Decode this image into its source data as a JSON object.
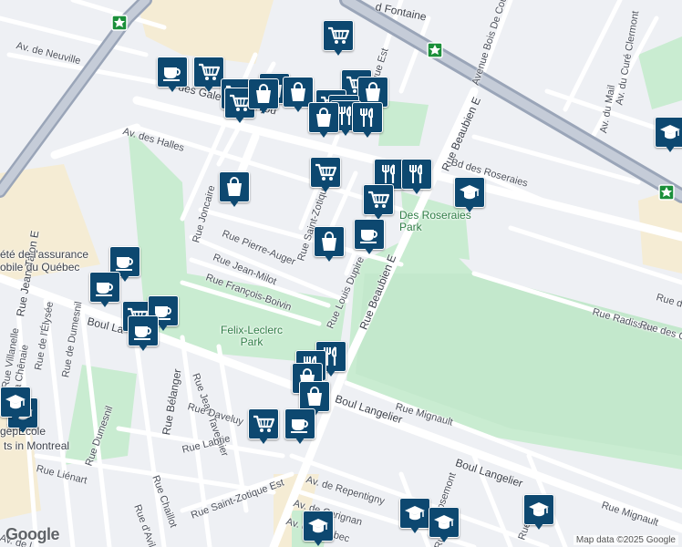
{
  "streets": {
    "fontaine": "d Fontaine",
    "bois_de_coulonges": "Avenue Bois De Coulonges",
    "cure_clermont": "Av. du Curé Clermont",
    "mail": "Av. du Mail",
    "neuville": "Av. de Neuville",
    "galeries": "des Galeries d'Anjou",
    "zotique_top": "tique Est",
    "beaubien_top": "Rue Beaubien E",
    "roseraies": "Bd des Roseraies",
    "halles": "Av. des Halles",
    "jean_talon": "Rue Jean-Talon E",
    "joncaire": "Rue Joncaire",
    "saint_zotique": "Rue Saint-Zotique",
    "pierre_auger": "Rue Pierre-Auger",
    "jean_milot": "Rue Jean-Milot",
    "francois_boivin": "Rue François-Boivin",
    "louis_dupire": "Rue Louis Dupire",
    "beaubien": "Rue Beaubien E",
    "radisson": "Rue Radisson",
    "trianon": "Rue du Tri",
    "gros": "Rue des Gros",
    "boul_la": "Boul La",
    "villanelle": "Rue Villanelle",
    "dumesnil": "Rue de Dumesnil",
    "elysee": "Rue de l'Élysée",
    "chenaie": "Rue de la Chênaie",
    "belanger": "Rue Bélanger",
    "jean_tavernier": "Rue Jean-Tavernier",
    "daveluy": "Rue Daveluy",
    "boul_langelier": "Boul Langelier",
    "boul_langelier2": "Boul Langelier",
    "mignault": "Rue Mignault",
    "mignault2": "Rue Mignault",
    "labrie": "Rue Labrie",
    "dumesnil2": "Rue Dumesnil",
    "lienart": "Rue Liénart",
    "chaillot": "Rue Chaillot",
    "avila": "Rue d'Avila",
    "saint_zotique_est": "Rue Saint-Zotique Est",
    "repentigny": "Av. de Repentigny",
    "carignan": "Av. de Carignan",
    "quebec": "Av. de Québec",
    "rosemont": "Rosemont",
    "rue_b": "Rue B",
    "rue_le": "Rue Le",
    "av_de_l": "Av. de l"
  },
  "places": {
    "roseraies_park": "Des Roseraies\nPark",
    "felix_leclerc_park": "Felix-Leclerc\nPark",
    "saaq": "été de l'assurance\nobile du Québec",
    "cegep": "ts in Montreal",
    "cegep2": "gep",
    "ecole": "Ecole"
  },
  "icons": {
    "grocery": "shopping-cart-icon",
    "store": "shopping-bag-icon",
    "cafe": "coffee-cup-icon",
    "restaurant": "fork-knife-icon",
    "school": "graduation-cap-icon"
  },
  "colors": {
    "pin": "#0d4870",
    "park": "#c9ecd1",
    "highway": "#9aa5b8",
    "highlight_area": "#f5ecd4",
    "road": "#ffffff",
    "land": "#eef0f4"
  },
  "attribution": "Map data ©2025 Google",
  "logo": "Google"
}
